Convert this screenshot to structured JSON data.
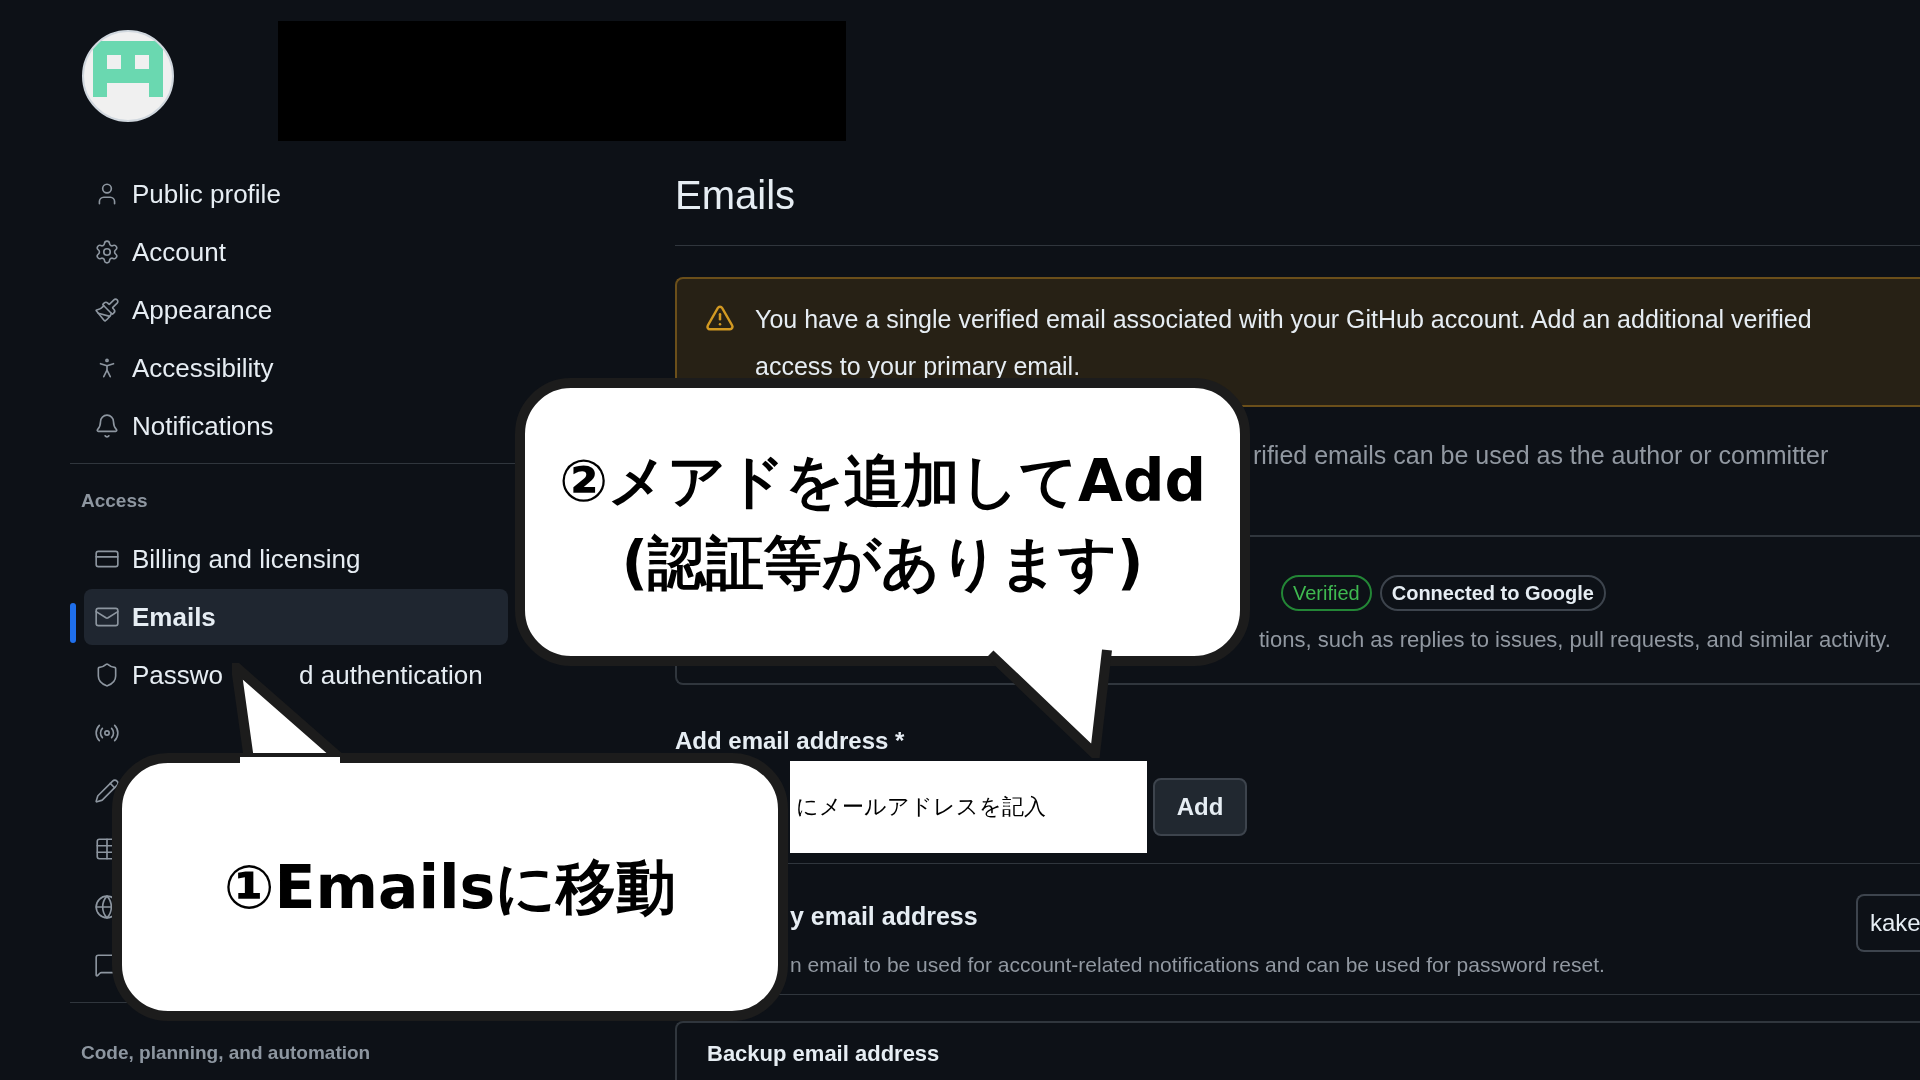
{
  "sidebar": {
    "items": [
      {
        "kind": "link",
        "parts": [
          "Public profile"
        ],
        "selected": false
      },
      {
        "kind": "link",
        "parts": [
          "Account"
        ],
        "selected": false
      },
      {
        "kind": "link",
        "parts": [
          "Appearance"
        ],
        "selected": false
      },
      {
        "kind": "link",
        "parts": [
          "Accessibility"
        ],
        "selected": false
      },
      {
        "kind": "link",
        "parts": [
          "Notifications"
        ],
        "selected": false
      },
      {
        "kind": "header",
        "parts": [
          "Access"
        ]
      },
      {
        "kind": "link",
        "parts": [
          "Billing and licensing"
        ],
        "selected": false
      },
      {
        "kind": "link",
        "parts": [
          "Emails"
        ],
        "selected": true
      },
      {
        "kind": "link",
        "parts": [
          "Passwo",
          "d authentication"
        ],
        "selected": false
      },
      {
        "kind": "link",
        "selected": false
      },
      {
        "kind": "link",
        "selected": false
      },
      {
        "kind": "link",
        "selected": false
      },
      {
        "kind": "link",
        "selected": false
      },
      {
        "kind": "link",
        "selected": false
      },
      {
        "kind": "header",
        "parts": [
          "Code, planning, and automation"
        ]
      }
    ]
  },
  "main": {
    "title": "Emails",
    "warning": {
      "lines": [
        "You have a single verified email associated with your GitHub account. Add an additional verified",
        "access to your primary email."
      ]
    },
    "intro": "rified emails can be used as the author or committer",
    "email_entry": {
      "badges": [
        {
          "label": "Verified",
          "kind": "verified"
        },
        {
          "label": "Connected to Google",
          "kind": "neutral"
        }
      ],
      "description": "tions, such as replies to issues, pull requests, and similar activity."
    },
    "add_email": {
      "label": "Add email address *",
      "value": "にメールアドレスを記入",
      "button": "Add"
    },
    "primary": {
      "title": "y email address",
      "description": "n email to be used for account-related notifications and can be used for password reset.",
      "select_value": "kake"
    },
    "backup": {
      "title": "Backup email address"
    }
  },
  "callouts": [
    {
      "text_lines": [
        "②メアドを追加してAdd",
        "(認証等があります)"
      ]
    },
    {
      "text_lines": [
        "①Emailsに移動"
      ]
    }
  ]
}
